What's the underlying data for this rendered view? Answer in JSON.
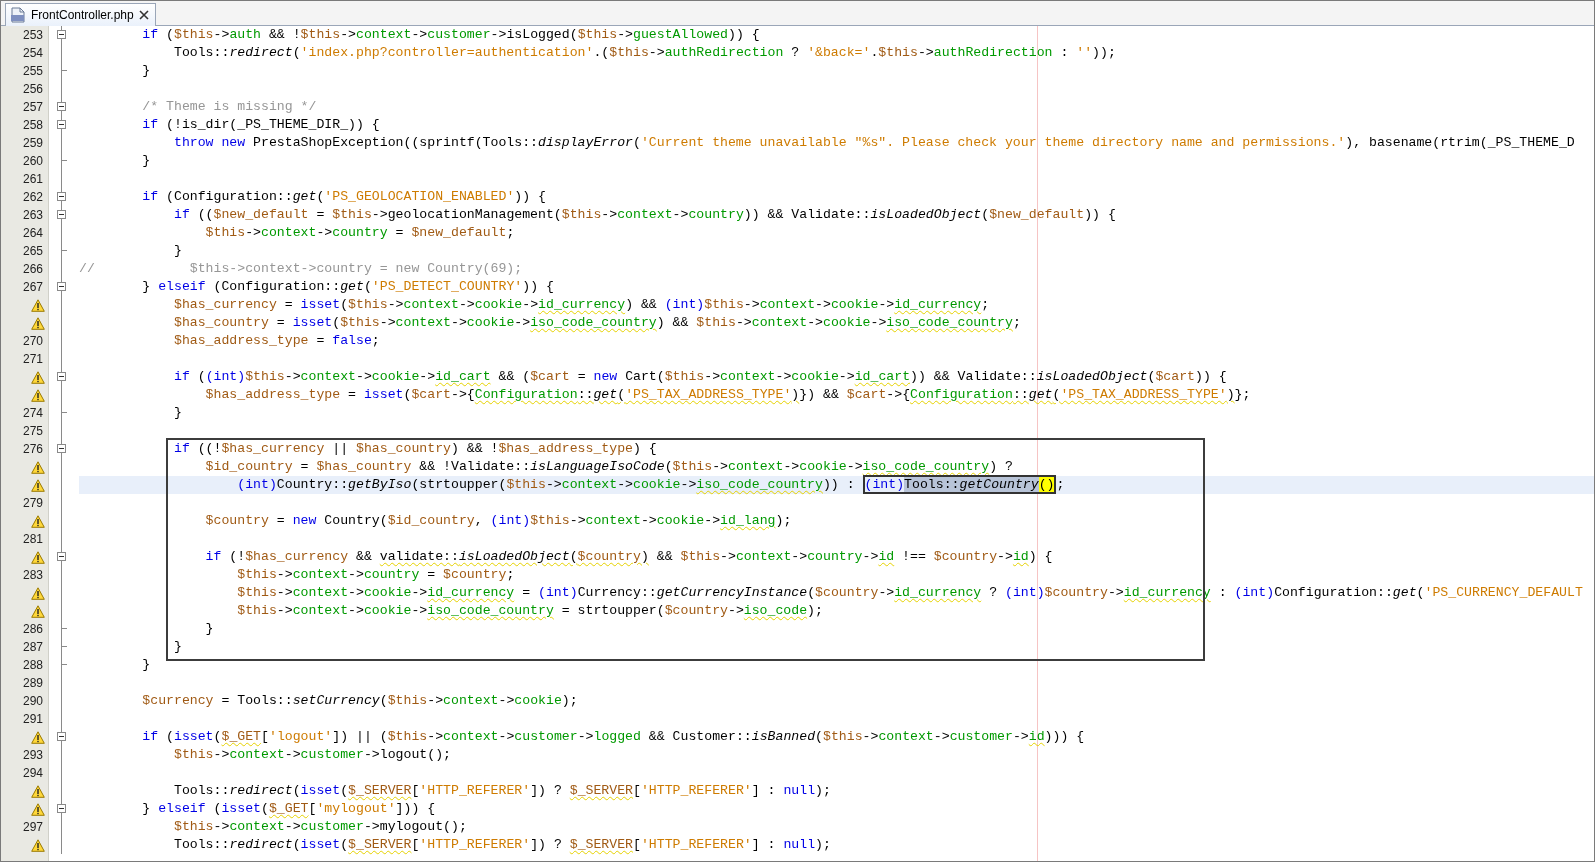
{
  "tab": {
    "title": "FrontController.php",
    "selected": true
  },
  "lines": [
    {
      "number": "253",
      "warning": false,
      "kind": "open",
      "current": false,
      "boxed": false,
      "code": [
        {
          "kind": "keyword",
          "text": "        if"
        },
        {
          "kind": "plain",
          "text": " ("
        },
        {
          "kind": "variable",
          "text": "$this"
        },
        {
          "kind": "plain",
          "text": "->"
        },
        {
          "kind": "field",
          "text": "auth"
        },
        {
          "kind": "plain",
          "text": " && !"
        },
        {
          "kind": "variable",
          "text": "$this"
        },
        {
          "kind": "plain",
          "text": "->"
        },
        {
          "kind": "field",
          "text": "context"
        },
        {
          "kind": "plain",
          "text": "->"
        },
        {
          "kind": "field",
          "text": "customer"
        },
        {
          "kind": "plain",
          "text": "->isLogged("
        },
        {
          "kind": "variable",
          "text": "$this"
        },
        {
          "kind": "plain",
          "text": "->"
        },
        {
          "kind": "field",
          "text": "guestAllowed"
        },
        {
          "kind": "plain",
          "text": ")) {"
        }
      ]
    },
    {
      "number": "254",
      "warning": false,
      "kind": "line",
      "current": false,
      "boxed": false,
      "code": [
        {
          "kind": "plain",
          "text": "            Tools::"
        },
        {
          "kind": "call",
          "text": "redirect"
        },
        {
          "kind": "plain",
          "text": "("
        },
        {
          "kind": "string",
          "text": "'index.php?controller=authentication'"
        },
        {
          "kind": "plain",
          "text": ".("
        },
        {
          "kind": "variable",
          "text": "$this"
        },
        {
          "kind": "plain",
          "text": "->"
        },
        {
          "kind": "field",
          "text": "authRedirection"
        },
        {
          "kind": "plain",
          "text": " ? "
        },
        {
          "kind": "string",
          "text": "'&back='"
        },
        {
          "kind": "plain",
          "text": "."
        },
        {
          "kind": "variable",
          "text": "$this"
        },
        {
          "kind": "plain",
          "text": "->"
        },
        {
          "kind": "field",
          "text": "authRedirection"
        },
        {
          "kind": "plain",
          "text": " : "
        },
        {
          "kind": "string",
          "text": "''"
        },
        {
          "kind": "plain",
          "text": "));"
        }
      ]
    },
    {
      "number": "255",
      "warning": false,
      "kind": "end",
      "current": false,
      "boxed": false,
      "code": [
        {
          "kind": "plain",
          "text": "        }"
        }
      ]
    },
    {
      "number": "256",
      "warning": false,
      "kind": "line",
      "current": false,
      "boxed": false
    },
    {
      "number": "257",
      "warning": false,
      "kind": "open",
      "current": false,
      "boxed": false,
      "code": [
        {
          "kind": "comment",
          "text": "        /* Theme is missing */"
        }
      ]
    },
    {
      "number": "258",
      "warning": false,
      "kind": "open",
      "current": false,
      "boxed": false,
      "code": [
        {
          "kind": "keyword",
          "text": "        if"
        },
        {
          "kind": "plain",
          "text": " (!is_dir(_PS_THEME_DIR_)) {"
        }
      ]
    },
    {
      "number": "259",
      "warning": false,
      "kind": "line",
      "current": false,
      "boxed": false,
      "code": [
        {
          "kind": "keyword",
          "text": "            throw new"
        },
        {
          "kind": "plain",
          "text": " PrestaShopException((sprintf(Tools::"
        },
        {
          "kind": "call",
          "text": "displayError"
        },
        {
          "kind": "plain",
          "text": "("
        },
        {
          "kind": "string",
          "text": "'Current theme unavailable \"%s\". Please check your theme directory name and permissions.'"
        },
        {
          "kind": "plain",
          "text": "), basename(rtrim(_PS_THEME_D"
        }
      ]
    },
    {
      "number": "260",
      "warning": false,
      "kind": "end",
      "current": false,
      "boxed": false,
      "code": [
        {
          "kind": "plain",
          "text": "        }"
        }
      ]
    },
    {
      "number": "261",
      "warning": false,
      "kind": "line",
      "current": false,
      "boxed": false
    },
    {
      "number": "262",
      "warning": false,
      "kind": "open",
      "current": false,
      "boxed": false,
      "code": [
        {
          "kind": "keyword",
          "text": "        if"
        },
        {
          "kind": "plain",
          "text": " (Configuration::"
        },
        {
          "kind": "call",
          "text": "get"
        },
        {
          "kind": "plain",
          "text": "("
        },
        {
          "kind": "string",
          "text": "'PS_GEOLOCATION_ENABLED'"
        },
        {
          "kind": "plain",
          "text": ")) {"
        }
      ]
    },
    {
      "number": "263",
      "warning": false,
      "kind": "open",
      "current": false,
      "boxed": false,
      "code": [
        {
          "kind": "keyword",
          "text": "            if"
        },
        {
          "kind": "plain",
          "text": " (("
        },
        {
          "kind": "variable",
          "text": "$new_default"
        },
        {
          "kind": "plain",
          "text": " = "
        },
        {
          "kind": "variable",
          "text": "$this"
        },
        {
          "kind": "plain",
          "text": "->geolocationManagement("
        },
        {
          "kind": "variable",
          "text": "$this"
        },
        {
          "kind": "plain",
          "text": "->"
        },
        {
          "kind": "field",
          "text": "context"
        },
        {
          "kind": "plain",
          "text": "->"
        },
        {
          "kind": "field",
          "text": "country"
        },
        {
          "kind": "plain",
          "text": ")) && Validate::"
        },
        {
          "kind": "call",
          "text": "isLoadedObject"
        },
        {
          "kind": "plain",
          "text": "("
        },
        {
          "kind": "variable",
          "text": "$new_default"
        },
        {
          "kind": "plain",
          "text": ")) {"
        }
      ]
    },
    {
      "number": "264",
      "warning": false,
      "kind": "line",
      "current": false,
      "boxed": false,
      "code": [
        {
          "kind": "variable",
          "text": "                $this"
        },
        {
          "kind": "plain",
          "text": "->"
        },
        {
          "kind": "field",
          "text": "context"
        },
        {
          "kind": "plain",
          "text": "->"
        },
        {
          "kind": "field",
          "text": "country"
        },
        {
          "kind": "plain",
          "text": " = "
        },
        {
          "kind": "variable",
          "text": "$new_default"
        },
        {
          "kind": "plain",
          "text": ";"
        }
      ]
    },
    {
      "number": "265",
      "warning": false,
      "kind": "end",
      "current": false,
      "boxed": false,
      "code": [
        {
          "kind": "plain",
          "text": "            }"
        }
      ]
    },
    {
      "number": "266",
      "warning": false,
      "kind": "line",
      "current": false,
      "boxed": false,
      "code": [
        {
          "kind": "comment",
          "text": "//            $this->context->country = new Country(69);"
        }
      ]
    },
    {
      "number": "267",
      "warning": false,
      "kind": "open",
      "current": false,
      "boxed": false,
      "code": [
        {
          "kind": "plain",
          "text": "        } "
        },
        {
          "kind": "keyword",
          "text": "elseif"
        },
        {
          "kind": "plain",
          "text": " (Configuration::"
        },
        {
          "kind": "call",
          "text": "get"
        },
        {
          "kind": "plain",
          "text": "("
        },
        {
          "kind": "string",
          "text": "'PS_DETECT_COUNTRY'"
        },
        {
          "kind": "plain",
          "text": ")) {"
        }
      ]
    },
    {
      "warning": true,
      "kind": "line",
      "current": false,
      "boxed": false,
      "code": [
        {
          "kind": "variable",
          "text": "            $has_currency"
        },
        {
          "kind": "plain",
          "text": " = "
        },
        {
          "kind": "keyword",
          "text": "isset"
        },
        {
          "kind": "plain",
          "text": "("
        },
        {
          "kind": "variable",
          "text": "$this"
        },
        {
          "kind": "plain",
          "text": "->"
        },
        {
          "kind": "field",
          "text": "context"
        },
        {
          "kind": "plain",
          "text": "->"
        },
        {
          "kind": "field",
          "text": "cookie"
        },
        {
          "kind": "plain",
          "text": "->"
        },
        {
          "kind": "field",
          "text": "id_currency",
          "squiggle": true
        },
        {
          "kind": "plain",
          "text": ") && "
        },
        {
          "kind": "keyword",
          "text": "(int)"
        },
        {
          "kind": "variable",
          "text": "$this"
        },
        {
          "kind": "plain",
          "text": "->"
        },
        {
          "kind": "field",
          "text": "context"
        },
        {
          "kind": "plain",
          "text": "->"
        },
        {
          "kind": "field",
          "text": "cookie"
        },
        {
          "kind": "plain",
          "text": "->"
        },
        {
          "kind": "field",
          "text": "id_currency",
          "squiggle": true
        },
        {
          "kind": "plain",
          "text": ";"
        }
      ]
    },
    {
      "warning": true,
      "kind": "line",
      "current": false,
      "boxed": false,
      "code": [
        {
          "kind": "variable",
          "text": "            $has_country"
        },
        {
          "kind": "plain",
          "text": " = "
        },
        {
          "kind": "keyword",
          "text": "isset"
        },
        {
          "kind": "plain",
          "text": "("
        },
        {
          "kind": "variable",
          "text": "$this"
        },
        {
          "kind": "plain",
          "text": "->"
        },
        {
          "kind": "field",
          "text": "context"
        },
        {
          "kind": "plain",
          "text": "->"
        },
        {
          "kind": "field",
          "text": "cookie"
        },
        {
          "kind": "plain",
          "text": "->"
        },
        {
          "kind": "field",
          "text": "iso_code_country",
          "squiggle": true
        },
        {
          "kind": "plain",
          "text": ") && "
        },
        {
          "kind": "variable",
          "text": "$this"
        },
        {
          "kind": "plain",
          "text": "->"
        },
        {
          "kind": "field",
          "text": "context"
        },
        {
          "kind": "plain",
          "text": "->"
        },
        {
          "kind": "field",
          "text": "cookie"
        },
        {
          "kind": "plain",
          "text": "->"
        },
        {
          "kind": "field",
          "text": "iso_code_country",
          "squiggle": true
        },
        {
          "kind": "plain",
          "text": ";"
        }
      ]
    },
    {
      "number": "270",
      "warning": false,
      "kind": "line",
      "current": false,
      "boxed": false,
      "code": [
        {
          "kind": "variable",
          "text": "            $has_address_type"
        },
        {
          "kind": "plain",
          "text": " = "
        },
        {
          "kind": "keyword",
          "text": "false"
        },
        {
          "kind": "plain",
          "text": ";"
        }
      ]
    },
    {
      "number": "271",
      "warning": false,
      "kind": "line",
      "current": false,
      "boxed": false
    },
    {
      "warning": true,
      "kind": "open",
      "current": false,
      "boxed": false,
      "code": [
        {
          "kind": "keyword",
          "text": "            if"
        },
        {
          "kind": "plain",
          "text": " ("
        },
        {
          "kind": "keyword",
          "text": "(int)"
        },
        {
          "kind": "variable",
          "text": "$this"
        },
        {
          "kind": "plain",
          "text": "->"
        },
        {
          "kind": "field",
          "text": "context"
        },
        {
          "kind": "plain",
          "text": "->"
        },
        {
          "kind": "field",
          "text": "cookie"
        },
        {
          "kind": "plain",
          "text": "->"
        },
        {
          "kind": "field",
          "text": "id_cart",
          "squiggle": true
        },
        {
          "kind": "plain",
          "text": " && ("
        },
        {
          "kind": "variable",
          "text": "$cart"
        },
        {
          "kind": "plain",
          "text": " = "
        },
        {
          "kind": "keyword",
          "text": "new"
        },
        {
          "kind": "plain",
          "text": " Cart("
        },
        {
          "kind": "variable",
          "text": "$this"
        },
        {
          "kind": "plain",
          "text": "->"
        },
        {
          "kind": "field",
          "text": "context"
        },
        {
          "kind": "plain",
          "text": "->"
        },
        {
          "kind": "field",
          "text": "cookie"
        },
        {
          "kind": "plain",
          "text": "->"
        },
        {
          "kind": "field",
          "text": "id_cart",
          "squiggle": true
        },
        {
          "kind": "plain",
          "text": ")) && Validate::"
        },
        {
          "kind": "call",
          "text": "isLoadedObject"
        },
        {
          "kind": "plain",
          "text": "("
        },
        {
          "kind": "variable",
          "text": "$cart"
        },
        {
          "kind": "plain",
          "text": ")) {"
        }
      ]
    },
    {
      "warning": true,
      "kind": "line",
      "current": false,
      "boxed": false,
      "code": [
        {
          "kind": "variable",
          "text": "                $has_address_type"
        },
        {
          "kind": "plain",
          "text": " = "
        },
        {
          "kind": "keyword",
          "text": "isset"
        },
        {
          "kind": "plain",
          "text": "("
        },
        {
          "kind": "variable",
          "text": "$cart"
        },
        {
          "kind": "plain",
          "text": "->{"
        },
        {
          "kind": "field",
          "text": "Configuration",
          "squiggle": true
        },
        {
          "kind": "plain",
          "text": "::",
          "squiggle": true
        },
        {
          "kind": "call",
          "text": "get",
          "squiggle": true
        },
        {
          "kind": "plain",
          "text": "(",
          "squiggle": true
        },
        {
          "kind": "string",
          "text": "'PS_TAX_ADDRESS_TYPE'",
          "squiggle": true
        },
        {
          "kind": "plain",
          "text": ")",
          "squiggle": true
        },
        {
          "kind": "plain",
          "text": "}) && "
        },
        {
          "kind": "variable",
          "text": "$cart"
        },
        {
          "kind": "plain",
          "text": "->{"
        },
        {
          "kind": "field",
          "text": "Configuration",
          "squiggle": true
        },
        {
          "kind": "plain",
          "text": "::",
          "squiggle": true
        },
        {
          "kind": "call",
          "text": "get",
          "squiggle": true
        },
        {
          "kind": "plain",
          "text": "(",
          "squiggle": true
        },
        {
          "kind": "string",
          "text": "'PS_TAX_ADDRESS_TYPE'",
          "squiggle": true
        },
        {
          "kind": "plain",
          "text": ")",
          "squiggle": true
        },
        {
          "kind": "plain",
          "text": "};"
        }
      ]
    },
    {
      "number": "274",
      "warning": false,
      "kind": "end",
      "current": false,
      "boxed": false,
      "code": [
        {
          "kind": "plain",
          "text": "            }"
        }
      ]
    },
    {
      "number": "275",
      "warning": false,
      "kind": "line",
      "current": false,
      "boxed": false
    },
    {
      "number": "276",
      "warning": false,
      "kind": "open",
      "current": false,
      "boxed": true,
      "code": [
        {
          "kind": "keyword",
          "text": "            if"
        },
        {
          "kind": "plain",
          "text": " ((!"
        },
        {
          "kind": "variable",
          "text": "$has_currency"
        },
        {
          "kind": "plain",
          "text": " || "
        },
        {
          "kind": "variable",
          "text": "$has_country"
        },
        {
          "kind": "plain",
          "text": ") && !"
        },
        {
          "kind": "variable",
          "text": "$has_address_type"
        },
        {
          "kind": "plain",
          "text": ") {"
        }
      ]
    },
    {
      "warning": true,
      "kind": "line",
      "current": false,
      "boxed": true,
      "code": [
        {
          "kind": "variable",
          "text": "                $id_country"
        },
        {
          "kind": "plain",
          "text": " = "
        },
        {
          "kind": "variable",
          "text": "$has_country"
        },
        {
          "kind": "plain",
          "text": " && !Validate::"
        },
        {
          "kind": "call",
          "text": "isLanguageIsoCode"
        },
        {
          "kind": "plain",
          "text": "("
        },
        {
          "kind": "variable",
          "text": "$this"
        },
        {
          "kind": "plain",
          "text": "->"
        },
        {
          "kind": "field",
          "text": "context"
        },
        {
          "kind": "plain",
          "text": "->"
        },
        {
          "kind": "field",
          "text": "cookie"
        },
        {
          "kind": "plain",
          "text": "->"
        },
        {
          "kind": "field",
          "text": "iso_code_country",
          "squiggle": true
        },
        {
          "kind": "plain",
          "text": ") ?"
        }
      ]
    },
    {
      "warning": true,
      "kind": "line",
      "current": true,
      "boxed": true,
      "code": [
        {
          "kind": "keyword",
          "text": "                    (int)"
        },
        {
          "kind": "plain",
          "text": "Country::"
        },
        {
          "kind": "call",
          "text": "getByIso"
        },
        {
          "kind": "plain",
          "text": "(strtoupper("
        },
        {
          "kind": "variable",
          "text": "$this"
        },
        {
          "kind": "plain",
          "text": "->"
        },
        {
          "kind": "field",
          "text": "context"
        },
        {
          "kind": "plain",
          "text": "->"
        },
        {
          "kind": "field",
          "text": "cookie"
        },
        {
          "kind": "plain",
          "text": "->"
        },
        {
          "kind": "field",
          "text": "iso_code_country",
          "squiggle": true
        },
        {
          "kind": "plain",
          "text": ")) : "
        },
        {
          "kind": "keyword",
          "text": "(int)",
          "framed": true
        },
        {
          "kind": "plain",
          "text": "Tools::",
          "framed": true,
          "selected": true
        },
        {
          "kind": "call",
          "text": "getCountry",
          "framed": true,
          "selected": true
        },
        {
          "kind": "plain",
          "text": "()",
          "framed": true,
          "matched": true
        },
        {
          "kind": "plain",
          "text": ";"
        }
      ]
    },
    {
      "number": "279",
      "warning": false,
      "kind": "line",
      "current": false,
      "boxed": true
    },
    {
      "warning": true,
      "kind": "line",
      "current": false,
      "boxed": true,
      "code": [
        {
          "kind": "variable",
          "text": "                $country"
        },
        {
          "kind": "plain",
          "text": " = "
        },
        {
          "kind": "keyword",
          "text": "new"
        },
        {
          "kind": "plain",
          "text": " Country("
        },
        {
          "kind": "variable",
          "text": "$id_country"
        },
        {
          "kind": "plain",
          "text": ", "
        },
        {
          "kind": "keyword",
          "text": "(int)"
        },
        {
          "kind": "variable",
          "text": "$this"
        },
        {
          "kind": "plain",
          "text": "->"
        },
        {
          "kind": "field",
          "text": "context"
        },
        {
          "kind": "plain",
          "text": "->"
        },
        {
          "kind": "field",
          "text": "cookie"
        },
        {
          "kind": "plain",
          "text": "->"
        },
        {
          "kind": "field",
          "text": "id_lang",
          "squiggle": true
        },
        {
          "kind": "plain",
          "text": ");"
        }
      ]
    },
    {
      "number": "281",
      "warning": false,
      "kind": "line",
      "current": false,
      "boxed": true
    },
    {
      "warning": true,
      "kind": "open",
      "current": false,
      "boxed": true,
      "code": [
        {
          "kind": "keyword",
          "text": "                if"
        },
        {
          "kind": "plain",
          "text": " (!"
        },
        {
          "kind": "variable",
          "text": "$has_currency"
        },
        {
          "kind": "plain",
          "text": " && "
        },
        {
          "kind": "plain",
          "text": "validate::",
          "squiggle": true
        },
        {
          "kind": "call",
          "text": "isLoadedObject",
          "squiggle": true
        },
        {
          "kind": "plain",
          "text": "(",
          "squiggle": true
        },
        {
          "kind": "variable",
          "text": "$country",
          "squiggle": true
        },
        {
          "kind": "plain",
          "text": ")",
          "squiggle": true
        },
        {
          "kind": "plain",
          "text": " && "
        },
        {
          "kind": "variable",
          "text": "$this"
        },
        {
          "kind": "plain",
          "text": "->"
        },
        {
          "kind": "field",
          "text": "context"
        },
        {
          "kind": "plain",
          "text": "->"
        },
        {
          "kind": "field",
          "text": "country"
        },
        {
          "kind": "plain",
          "text": "->"
        },
        {
          "kind": "field",
          "text": "id",
          "squiggle": true
        },
        {
          "kind": "plain",
          "text": " !== "
        },
        {
          "kind": "variable",
          "text": "$country"
        },
        {
          "kind": "plain",
          "text": "->"
        },
        {
          "kind": "field",
          "text": "id",
          "squiggle": true
        },
        {
          "kind": "plain",
          "text": ") {"
        }
      ]
    },
    {
      "number": "283",
      "warning": false,
      "kind": "line",
      "current": false,
      "boxed": true,
      "code": [
        {
          "kind": "variable",
          "text": "                    $this"
        },
        {
          "kind": "plain",
          "text": "->"
        },
        {
          "kind": "field",
          "text": "context"
        },
        {
          "kind": "plain",
          "text": "->"
        },
        {
          "kind": "field",
          "text": "country"
        },
        {
          "kind": "plain",
          "text": " = "
        },
        {
          "kind": "variable",
          "text": "$country"
        },
        {
          "kind": "plain",
          "text": ";"
        }
      ]
    },
    {
      "warning": true,
      "kind": "line",
      "current": false,
      "boxed": true,
      "code": [
        {
          "kind": "variable",
          "text": "                    $this"
        },
        {
          "kind": "plain",
          "text": "->"
        },
        {
          "kind": "field",
          "text": "context"
        },
        {
          "kind": "plain",
          "text": "->"
        },
        {
          "kind": "field",
          "text": "cookie"
        },
        {
          "kind": "plain",
          "text": "->"
        },
        {
          "kind": "field",
          "text": "id_currency",
          "squiggle": true
        },
        {
          "kind": "plain",
          "text": " = "
        },
        {
          "kind": "keyword",
          "text": "(int)"
        },
        {
          "kind": "plain",
          "text": "Currency::"
        },
        {
          "kind": "call",
          "text": "getCurrencyInstance"
        },
        {
          "kind": "plain",
          "text": "("
        },
        {
          "kind": "variable",
          "text": "$country"
        },
        {
          "kind": "plain",
          "text": "->"
        },
        {
          "kind": "field",
          "text": "id_currency",
          "squiggle": true
        },
        {
          "kind": "plain",
          "text": " ? "
        },
        {
          "kind": "keyword",
          "text": "(int)"
        },
        {
          "kind": "variable",
          "text": "$country"
        },
        {
          "kind": "plain",
          "text": "->"
        },
        {
          "kind": "field",
          "text": "id_currency",
          "squiggle": true
        },
        {
          "kind": "plain",
          "text": " : "
        },
        {
          "kind": "keyword",
          "text": "(int)"
        },
        {
          "kind": "plain",
          "text": "Configuration::"
        },
        {
          "kind": "call",
          "text": "get"
        },
        {
          "kind": "plain",
          "text": "("
        },
        {
          "kind": "string",
          "text": "'PS_CURRENCY_DEFAULT"
        }
      ]
    },
    {
      "warning": true,
      "kind": "line",
      "current": false,
      "boxed": true,
      "code": [
        {
          "kind": "variable",
          "text": "                    $this"
        },
        {
          "kind": "plain",
          "text": "->"
        },
        {
          "kind": "field",
          "text": "context"
        },
        {
          "kind": "plain",
          "text": "->"
        },
        {
          "kind": "field",
          "text": "cookie"
        },
        {
          "kind": "plain",
          "text": "->"
        },
        {
          "kind": "field",
          "text": "iso_code_country",
          "squiggle": true
        },
        {
          "kind": "plain",
          "text": " = strtoupper("
        },
        {
          "kind": "variable",
          "text": "$country"
        },
        {
          "kind": "plain",
          "text": "->"
        },
        {
          "kind": "field",
          "text": "iso_code",
          "squiggle": true
        },
        {
          "kind": "plain",
          "text": ");"
        }
      ]
    },
    {
      "number": "286",
      "warning": false,
      "kind": "end",
      "current": false,
      "boxed": true,
      "code": [
        {
          "kind": "plain",
          "text": "                }"
        }
      ]
    },
    {
      "number": "287",
      "warning": false,
      "kind": "end",
      "current": false,
      "boxed": true,
      "code": [
        {
          "kind": "plain",
          "text": "            }"
        }
      ]
    },
    {
      "number": "288",
      "warning": false,
      "kind": "end",
      "current": false,
      "boxed": false,
      "code": [
        {
          "kind": "plain",
          "text": "        }"
        }
      ]
    },
    {
      "number": "289",
      "warning": false,
      "kind": "line",
      "current": false,
      "boxed": false
    },
    {
      "number": "290",
      "warning": false,
      "kind": "line",
      "current": false,
      "boxed": false,
      "code": [
        {
          "kind": "variable",
          "text": "        $currency"
        },
        {
          "kind": "plain",
          "text": " = Tools::"
        },
        {
          "kind": "call",
          "text": "setCurrency"
        },
        {
          "kind": "plain",
          "text": "("
        },
        {
          "kind": "variable",
          "text": "$this"
        },
        {
          "kind": "plain",
          "text": "->"
        },
        {
          "kind": "field",
          "text": "context"
        },
        {
          "kind": "plain",
          "text": "->"
        },
        {
          "kind": "field",
          "text": "cookie"
        },
        {
          "kind": "plain",
          "text": ");"
        }
      ]
    },
    {
      "number": "291",
      "warning": false,
      "kind": "line",
      "current": false,
      "boxed": false
    },
    {
      "warning": true,
      "kind": "open",
      "current": false,
      "boxed": false,
      "code": [
        {
          "kind": "keyword",
          "text": "        if"
        },
        {
          "kind": "plain",
          "text": " ("
        },
        {
          "kind": "keyword",
          "text": "isset"
        },
        {
          "kind": "plain",
          "text": "("
        },
        {
          "kind": "variable",
          "text": "$_GET",
          "squiggle": true
        },
        {
          "kind": "plain",
          "text": "["
        },
        {
          "kind": "string",
          "text": "'logout'"
        },
        {
          "kind": "plain",
          "text": "]) || ("
        },
        {
          "kind": "variable",
          "text": "$this"
        },
        {
          "kind": "plain",
          "text": "->"
        },
        {
          "kind": "field",
          "text": "context"
        },
        {
          "kind": "plain",
          "text": "->"
        },
        {
          "kind": "field",
          "text": "customer"
        },
        {
          "kind": "plain",
          "text": "->"
        },
        {
          "kind": "field",
          "text": "logged"
        },
        {
          "kind": "plain",
          "text": " && Customer::"
        },
        {
          "kind": "call",
          "text": "isBanned"
        },
        {
          "kind": "plain",
          "text": "("
        },
        {
          "kind": "variable",
          "text": "$this"
        },
        {
          "kind": "plain",
          "text": "->"
        },
        {
          "kind": "field",
          "text": "context"
        },
        {
          "kind": "plain",
          "text": "->"
        },
        {
          "kind": "field",
          "text": "customer"
        },
        {
          "kind": "plain",
          "text": "->"
        },
        {
          "kind": "field",
          "text": "id",
          "squiggle": true
        },
        {
          "kind": "plain",
          "text": "))) {"
        }
      ]
    },
    {
      "number": "293",
      "warning": false,
      "kind": "line",
      "current": false,
      "boxed": false,
      "code": [
        {
          "kind": "variable",
          "text": "            $this"
        },
        {
          "kind": "plain",
          "text": "->"
        },
        {
          "kind": "field",
          "text": "context"
        },
        {
          "kind": "plain",
          "text": "->"
        },
        {
          "kind": "field",
          "text": "customer"
        },
        {
          "kind": "plain",
          "text": "->logout();"
        }
      ]
    },
    {
      "number": "294",
      "warning": false,
      "kind": "line",
      "current": false,
      "boxed": false
    },
    {
      "warning": true,
      "kind": "line",
      "current": false,
      "boxed": false,
      "code": [
        {
          "kind": "plain",
          "text": "            Tools::"
        },
        {
          "kind": "call",
          "text": "redirect"
        },
        {
          "kind": "plain",
          "text": "("
        },
        {
          "kind": "keyword",
          "text": "isset"
        },
        {
          "kind": "plain",
          "text": "("
        },
        {
          "kind": "variable",
          "text": "$_SERVER",
          "squiggle": true
        },
        {
          "kind": "plain",
          "text": "["
        },
        {
          "kind": "string",
          "text": "'HTTP_REFERER'"
        },
        {
          "kind": "plain",
          "text": "]) ? "
        },
        {
          "kind": "variable",
          "text": "$_SERVER",
          "squiggle": true
        },
        {
          "kind": "plain",
          "text": "["
        },
        {
          "kind": "string",
          "text": "'HTTP_REFERER'"
        },
        {
          "kind": "plain",
          "text": "] : "
        },
        {
          "kind": "keyword",
          "text": "null"
        },
        {
          "kind": "plain",
          "text": ");"
        }
      ]
    },
    {
      "warning": true,
      "kind": "open",
      "current": false,
      "boxed": false,
      "code": [
        {
          "kind": "plain",
          "text": "        } "
        },
        {
          "kind": "keyword",
          "text": "elseif"
        },
        {
          "kind": "plain",
          "text": " ("
        },
        {
          "kind": "keyword",
          "text": "isset"
        },
        {
          "kind": "plain",
          "text": "("
        },
        {
          "kind": "variable",
          "text": "$_GET",
          "squiggle": true
        },
        {
          "kind": "plain",
          "text": "["
        },
        {
          "kind": "string",
          "text": "'mylogout'"
        },
        {
          "kind": "plain",
          "text": "])) {"
        }
      ]
    },
    {
      "number": "297",
      "warning": false,
      "kind": "line",
      "current": false,
      "boxed": false,
      "code": [
        {
          "kind": "variable",
          "text": "            $this"
        },
        {
          "kind": "plain",
          "text": "->"
        },
        {
          "kind": "field",
          "text": "context"
        },
        {
          "kind": "plain",
          "text": "->"
        },
        {
          "kind": "field",
          "text": "customer"
        },
        {
          "kind": "plain",
          "text": "->mylogout();"
        }
      ]
    },
    {
      "warning": true,
      "kind": "line",
      "current": false,
      "boxed": false,
      "code": [
        {
          "kind": "plain",
          "text": "            Tools::"
        },
        {
          "kind": "call",
          "text": "redirect"
        },
        {
          "kind": "plain",
          "text": "("
        },
        {
          "kind": "keyword",
          "text": "isset"
        },
        {
          "kind": "plain",
          "text": "("
        },
        {
          "kind": "variable",
          "text": "$_SERVER",
          "squiggle": true
        },
        {
          "kind": "plain",
          "text": "["
        },
        {
          "kind": "string",
          "text": "'HTTP_REFERER'"
        },
        {
          "kind": "plain",
          "text": "]) ? "
        },
        {
          "kind": "variable",
          "text": "$_SERVER",
          "squiggle": true
        },
        {
          "kind": "plain",
          "text": "["
        },
        {
          "kind": "string",
          "text": "'HTTP_REFERER'"
        },
        {
          "kind": "plain",
          "text": "] : "
        },
        {
          "kind": "keyword",
          "text": "null"
        },
        {
          "kind": "plain",
          "text": ");"
        }
      ]
    }
  ]
}
